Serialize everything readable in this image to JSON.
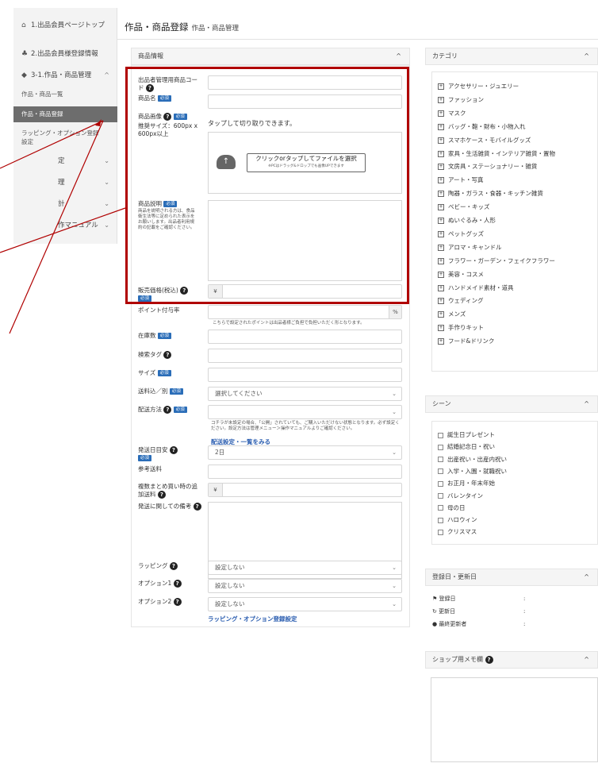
{
  "sidebar": {
    "items": [
      {
        "label": "1.出品会員ページトップ",
        "icon": "home-icon"
      },
      {
        "label": "2.出品会員様登録情報",
        "icon": "users-icon"
      },
      {
        "label": "3-1.作品・商品管理",
        "icon": "box-icon"
      }
    ],
    "sub_items": [
      {
        "label": "作品・商品一覧"
      },
      {
        "label": "作品・商品登録"
      },
      {
        "label": "ラッピング・オプション登録設定"
      }
    ],
    "partial_items": [
      "定",
      "理",
      "計",
      "作マニュアル"
    ]
  },
  "header": {
    "title": "作品・商品登録",
    "subtitle": "作品・商品管理"
  },
  "product_panel": {
    "title": "商品情報",
    "required_badge": "必須",
    "fields": {
      "code": {
        "label": "出品者管理用商品コード"
      },
      "name": {
        "label": "商品名"
      },
      "image": {
        "label": "商品画像",
        "hint": "推奨サイズ：600px x 600px以上",
        "tap_text": "タップして切り取りできます。",
        "upload_label": "クリックorタップしてファイルを選択",
        "upload_hint": "※PCはドラッグ&ドロップでも画像UPできます"
      },
      "description": {
        "label": "商品説明",
        "note": "商品を説明される方は、食品衛生法等に定められた表示をお願いします。出品者利用規約の記載をご確認ください。"
      },
      "price": {
        "label": "販売価格(税込)",
        "currency": "¥"
      },
      "points": {
        "label": "ポイント付与率",
        "unit": "%",
        "note": "こちらで設定されたポイントは出品者様ご負担で負担いただく形となります。"
      },
      "stock": {
        "label": "在庫数"
      },
      "tags": {
        "label": "検索タグ"
      },
      "size": {
        "label": "サイズ"
      },
      "shipping_incl": {
        "label": "送料込／別",
        "value": "選択してください"
      },
      "delivery": {
        "label": "配送方法",
        "note": "コチラが未設定の場合、「公開」されていても、ご購入いただけない状態となります。必ず設定ください。設定方法は管理メニュー＞操作マニュアルよりご確認ください。",
        "link": "配送設定・一覧をみる"
      },
      "ship_days": {
        "label": "発送日目安",
        "value": "2日"
      },
      "ref_shipping": {
        "label": "参考送料"
      },
      "bundle": {
        "label": "複数まとめ買い時の追加送料",
        "currency": "¥"
      },
      "ship_notes": {
        "label": "発送に関しての備考"
      },
      "wrapping": {
        "label": "ラッピング",
        "value": "設定しない"
      },
      "option1": {
        "label": "オプション1",
        "value": "設定しない"
      },
      "option2": {
        "label": "オプション2",
        "value": "設定しない"
      },
      "wrap_link": "ラッピング・オプション登録設定"
    }
  },
  "category_panel": {
    "title": "カテゴリ",
    "items": [
      "アクセサリー・ジュエリー",
      "ファッション",
      "マスク",
      "バッグ・鞄・財布・小物入れ",
      "スマホケース・モバイルグッズ",
      "家具・生活雑貨・インテリア雑貨・置物",
      "文房具・ステーショナリー・雑貨",
      "アート・写真",
      "陶器・ガラス・食器・キッチン雑貨",
      "ベビー・キッズ",
      "ぬいぐるみ・人形",
      "ペットグッズ",
      "アロマ・キャンドル",
      "フラワー・ガーデン・フェイクフラワー",
      "美容・コスメ",
      "ハンドメイド素材・道具",
      "ウェディング",
      "メンズ",
      "手作りキット",
      "フード&ドリンク"
    ]
  },
  "scene_panel": {
    "title": "シーン",
    "items": [
      "誕生日プレゼント",
      "結婚記念日・祝い",
      "出産祝い・出産内祝い",
      "入学・入園・就職祝い",
      "お正月・年末年始",
      "バレンタイン",
      "母の日",
      "ハロウィン",
      "クリスマス"
    ]
  },
  "dates_panel": {
    "title": "登録日・更新日",
    "rows": [
      {
        "label": "登録日",
        "icon": "flag-icon",
        "value": ":"
      },
      {
        "label": "更新日",
        "icon": "refresh-icon",
        "value": ":"
      },
      {
        "label": "最終更新者",
        "icon": "user-icon",
        "value": ":"
      }
    ]
  },
  "memo_panel": {
    "title": "ショップ用メモ欄"
  },
  "colors": {
    "highlight": "#b00000",
    "link": "#2a5db0",
    "required": "#2a6db8",
    "active_sidebar": "#6d6d6d"
  }
}
